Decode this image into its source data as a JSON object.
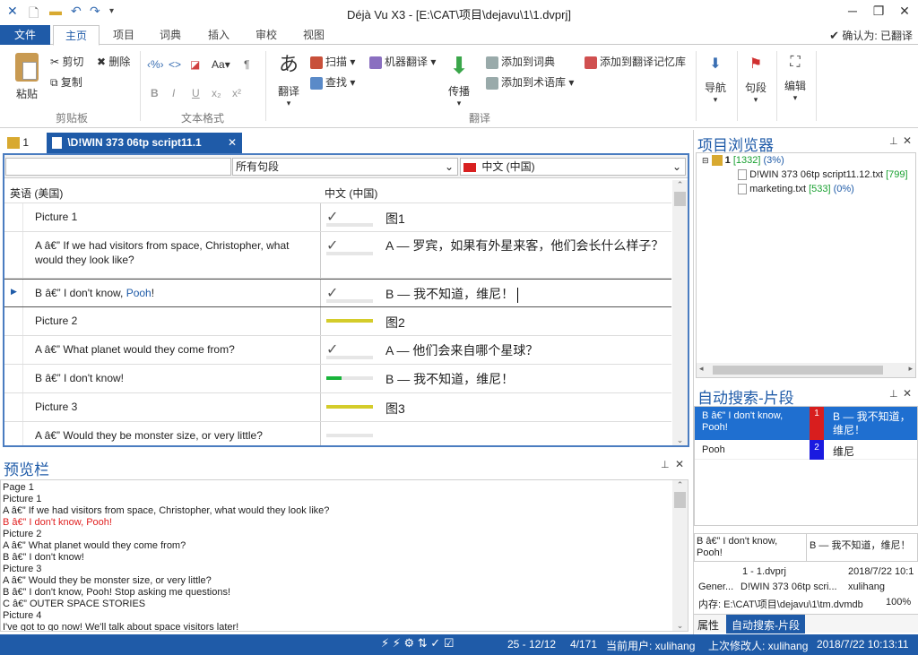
{
  "window": {
    "title": "Déjà Vu X3 - [E:\\CAT\\项目\\dejavu\\1\\1.dvprj]"
  },
  "menu": {
    "tabs": [
      "文件",
      "主页",
      "项目",
      "词典",
      "插入",
      "审校",
      "视图"
    ],
    "confirm_label": "确认为: 已翻译"
  },
  "ribbon": {
    "paste": "粘贴",
    "cut": "剪切",
    "copy": "复制",
    "delete": "删除",
    "clipboard_group": "剪贴板",
    "format_group": "文本格式",
    "translate_big": "翻译",
    "scan": "扫描",
    "find": "查找",
    "machine_translation": "机器翻译",
    "propagate": "传播",
    "add_to_dict": "添加到词典",
    "add_to_termbase": "添加到术语库",
    "add_to_tm": "添加到翻译记忆库",
    "translate_group": "翻译",
    "navigate": "导航",
    "segment": "句段",
    "edit": "编辑",
    "font_size": "Aa",
    "bold": "B",
    "italic": "I",
    "underline": "U",
    "subscript": "x₂",
    "superscript": "x²",
    "pilcrow": "¶"
  },
  "doc_tabs": {
    "tab1": "1",
    "tab2": "\\D!WIN 373 06tp script11.1"
  },
  "filter": {
    "text": "",
    "mode": "所有句段",
    "language": "中文 (中国)"
  },
  "grid": {
    "source_header": "英语 (美国)",
    "target_header": "中文 (中国)",
    "rows": [
      {
        "src": "Picture 1",
        "tgt": "图1",
        "status": "check"
      },
      {
        "src": "A â€” If we had visitors from space, Christopher, what would they look like?",
        "tgt": "A — 罗宾，如果有外星来客，他们会长什么样子？",
        "status": "check"
      },
      {
        "src_a": "B â€” I don't know, ",
        "src_b": "Pooh",
        "src_c": "!",
        "tgt": "B — 我不知道，维尼！",
        "status": "check"
      },
      {
        "src": "Picture 2",
        "tgt": "图2",
        "status": "yellow"
      },
      {
        "src": "A â€” What planet would they come from?",
        "tgt": "A — 他们会来自哪个星球？",
        "status": "check"
      },
      {
        "src": "B â€” I don't know!",
        "tgt": "B — 我不知道，维尼！",
        "status": "green"
      },
      {
        "src": "Picture 3",
        "tgt": "图3",
        "status": "yellow"
      },
      {
        "src": "A â€” Would they be monster size, or very little?",
        "tgt": "",
        "status": "empty"
      }
    ]
  },
  "preview": {
    "title": "预览栏",
    "lines": [
      "Page 1",
      "Picture 1",
      "A â€” If we had visitors from space, Christopher, what would they look like?",
      "B â€” I don't know, Pooh!",
      "Picture 2",
      "A â€” What planet would they come from?",
      "B â€” I don't know!",
      "Picture 3",
      "A â€” Would they be monster size, or very little?",
      "B â€” I don't know, Pooh! Stop asking me questions!",
      "C â€” OUTER SPACE STORIES",
      "Picture 4",
      "I've got to go now! We'll talk about space visitors later!"
    ],
    "highlight_index": 3
  },
  "project_browser": {
    "title": "项目浏览器",
    "root_label": "1",
    "root_count": "[1332]",
    "root_pct": "(3%)",
    "files": [
      {
        "name": "D!WIN 373 06tp script11.12.txt",
        "count": "[799]",
        "pct": ""
      },
      {
        "name": "marketing.txt",
        "count": "[533]",
        "pct": "(0%)"
      }
    ]
  },
  "autosearch": {
    "title": "自动搜索-片段",
    "items": [
      {
        "src": "B â€” I don't know, Pooh!",
        "num": "1",
        "tgt": "B — 我不知道，维尼！"
      },
      {
        "src": "Pooh",
        "num": "2",
        "tgt": "维尼"
      }
    ],
    "detail_src": "B â€” I don't know, Pooh!",
    "detail_tgt": "B — 我不知道，维尼！",
    "info_line1_a": "1 - 1.dvprj",
    "info_line1_b": "2018/7/22 10:1",
    "info_line2_a": "Gener...",
    "info_line2_b": "D!WIN 373 06tp scri...",
    "info_line2_c": "xulihang",
    "info_line3_a": "内存: E:\\CAT\\项目\\dejavu\\1\\tm.dvmdb",
    "info_line3_b": "100%",
    "tab_props": "属性",
    "tab_autosearch": "自动搜索-片段"
  },
  "status": {
    "position": "25 - 12/12",
    "count": "4/171",
    "current_user": "当前用户: xulihang",
    "last_modifier": "上次修改人: xulihang",
    "datetime": "2018/7/22 10:13:11"
  },
  "colors": {
    "accent": "#1f5ba8",
    "yellow_bar": "#d4cc2a",
    "green_bar": "#18b43a",
    "highlight_red": "#e02020"
  }
}
